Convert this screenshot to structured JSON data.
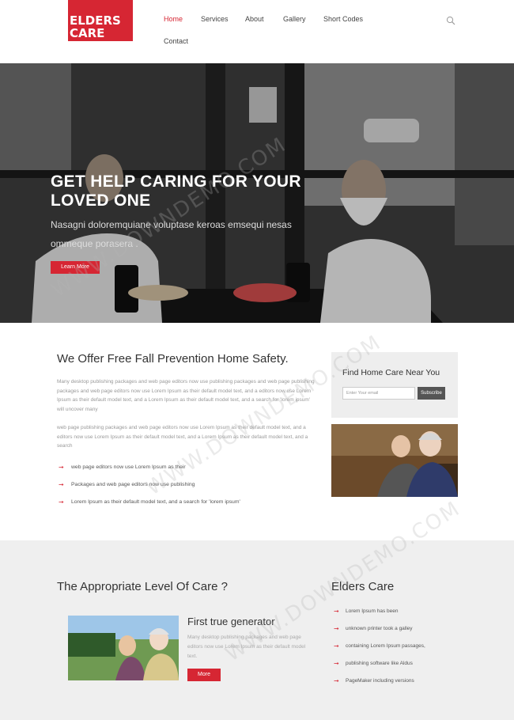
{
  "logo": {
    "line1": "ELDERS",
    "line2": "CARE"
  },
  "nav": {
    "items": [
      {
        "label": "Home"
      },
      {
        "label": "Services"
      },
      {
        "label": "About"
      },
      {
        "label": "Gallery"
      },
      {
        "label": "Short Codes"
      },
      {
        "label": "Contact"
      }
    ]
  },
  "hero": {
    "title": "GET HELP CARING FOR YOUR LOVED ONE",
    "text": "Nasagni doloremquiane voluptase keroas emsequi nesas ommeque porasera .",
    "button": "Learn More"
  },
  "safety": {
    "title": "We Offer Free Fall Prevention Home Safety.",
    "para1": "Many desktop publishing packages and web page editors now use publishing packages and web page publishing packages and web page editors now use Lorem Ipsum as their default model text, and a editors now use Lorem Ipsum as their default model text, and a Lorem Ipsum as their default model text, and a search for 'lorem ipsum' will uncover many",
    "para2": "web page publishing packages and web page editors now use Lorem Ipsum as their default model text, and a editors now use Lorem Ipsum as their default model text, and a Lorem Ipsum as their default model text, and a search",
    "list": [
      "web page editors now use Lorem Ipsum as their",
      "Packages and web page editors now use publishing",
      "Lorem Ipsum as their default model text, and a search for 'lorem ipsum'"
    ]
  },
  "find": {
    "title": "Find Home Care Near You",
    "email_placeholder": "Enter Your email",
    "subscribe": "Subscribe"
  },
  "level": {
    "title": "The Appropriate Level Of Care ?",
    "card_title": "First true generator",
    "card_text": "Many desktop publishing packages and web page editors now use Lorem Ipsum as their default model text.",
    "card_button": "More"
  },
  "elders": {
    "title": "Elders Care",
    "list": [
      "Lorem Ipsum has been",
      "unknown printer took a galley",
      "containing Lorem Ipsum passages,",
      "publishing software like Aldus",
      "PageMaker including versions"
    ]
  },
  "watermark": "WWW.DOWNDEMO.COM",
  "colors": {
    "accent": "#d62633",
    "section_bg": "#efefef"
  }
}
